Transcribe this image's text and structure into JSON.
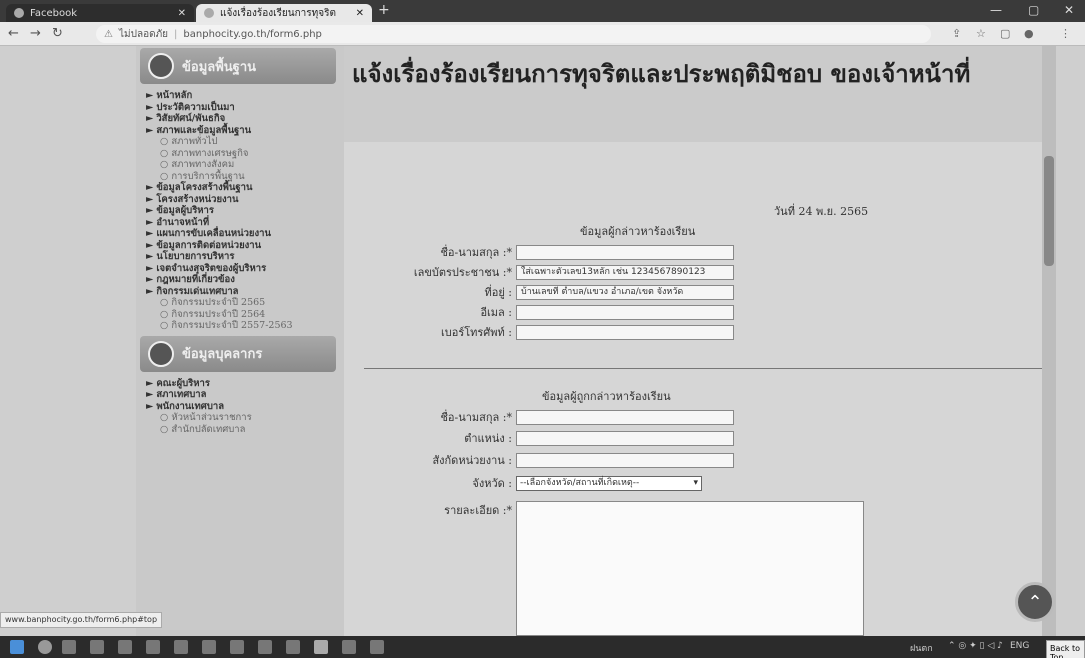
{
  "browser": {
    "tab1_title": "Facebook",
    "tab2_title": "แจ้งเรื่องร้องเรียนการทุจริต",
    "url_warning": "ไม่ปลอดภัย",
    "url": "banphocity.go.th/form6.php"
  },
  "sidebar": {
    "section1": "ข้อมูลพื้นฐาน",
    "items1": [
      {
        "label": "หน้าหลัก",
        "type": "main"
      },
      {
        "label": "ประวัติความเป็นมา",
        "type": "main"
      },
      {
        "label": "วิสัยทัศน์/พันธกิจ",
        "type": "main"
      },
      {
        "label": "สภาพและข้อมูลพื้นฐาน",
        "type": "main"
      },
      {
        "label": "สภาพทั่วไป",
        "type": "sub"
      },
      {
        "label": "สภาพทางเศรษฐกิจ",
        "type": "sub"
      },
      {
        "label": "สภาพทางสังคม",
        "type": "sub"
      },
      {
        "label": "การบริการพื้นฐาน",
        "type": "sub"
      },
      {
        "label": "ข้อมูลโครงสร้างพื้นฐาน",
        "type": "main"
      },
      {
        "label": "โครงสร้างหน่วยงาน",
        "type": "main"
      },
      {
        "label": "ข้อมูลผู้บริหาร",
        "type": "main"
      },
      {
        "label": "อำนาจหน้าที่",
        "type": "main"
      },
      {
        "label": "แผนการขับเคลื่อนหน่วยงาน",
        "type": "main"
      },
      {
        "label": "ข้อมูลการติดต่อหน่วยงาน",
        "type": "main"
      },
      {
        "label": "นโยบายการบริหาร",
        "type": "main"
      },
      {
        "label": "เจตจำนงสุจริตของผู้บริหาร",
        "type": "main"
      },
      {
        "label": "กฎหมายที่เกี่ยวข้อง",
        "type": "main"
      },
      {
        "label": "กิจกรรมเด่นเทศบาล",
        "type": "main"
      },
      {
        "label": "กิจกรรมประจำปี 2565",
        "type": "sub"
      },
      {
        "label": "กิจกรรมประจำปี 2564",
        "type": "sub"
      },
      {
        "label": "กิจกรรมประจำปี 2557-2563",
        "type": "sub"
      }
    ],
    "section2": "ข้อมูลบุคลากร",
    "items2": [
      {
        "label": "คณะผู้บริหาร",
        "type": "main"
      },
      {
        "label": "สภาเทศบาล",
        "type": "main"
      },
      {
        "label": "พนักงานเทศบาล",
        "type": "main"
      },
      {
        "label": "หัวหน้าส่วนราชการ",
        "type": "sub"
      },
      {
        "label": "สำนักปลัดเทศบาล",
        "type": "sub"
      }
    ]
  },
  "main": {
    "title": "แจ้งเรื่องร้องเรียนการทุจริตและประพฤติมิชอบ ของเจ้าหน้าที่",
    "date": "วันที่ 24 พ.ย. 2565",
    "complainant_section": "ข้อมูลผู้กล่าวหาร้องเรียน",
    "complainant": {
      "name_label": "ชื่อ-นามสกุล :*",
      "id_label": "เลขบัตรประชาชน :*",
      "id_placeholder": "ใส่เฉพาะตัวเลข13หลัก เช่น 1234567890123",
      "address_label": "ที่อยู่ :",
      "address_placeholder": "บ้านเลขที่ ตำบล/แขวง อำเภอ/เขต จังหวัด",
      "email_label": "อีเมล :",
      "phone_label": "เบอร์โทรศัพท์ :"
    },
    "accused_section": "ข้อมูลผู้ถูกกล่าวหาร้องเรียน",
    "accused": {
      "name_label": "ชื่อ-นามสกุล :*",
      "position_label": "ตำแหน่ง :",
      "agency_label": "สังกัดหน่วยงาน :",
      "province_label": "จังหวัด :",
      "province_selected": "--เลือกจังหวัด/สถานที่เกิดเหตุ--",
      "details_label": "รายละเอียด :*"
    }
  },
  "statusbar": "www.banphocity.go.th/form6.php#top",
  "taskbar": {
    "lang": "ENG",
    "weather": "ฝนตก",
    "back_to_top": "Back to Top"
  }
}
